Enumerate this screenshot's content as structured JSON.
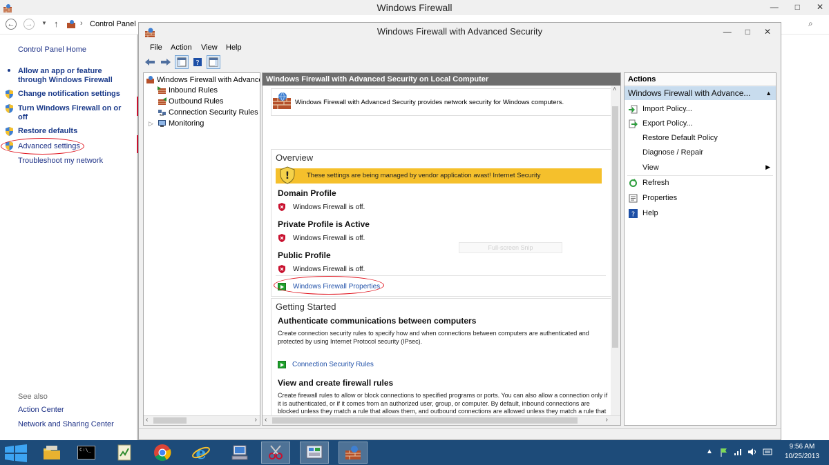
{
  "control_panel": {
    "title": "Windows Firewall",
    "window_buttons": {
      "minimize": "—",
      "maximize": "□",
      "close": "✕"
    },
    "address": {
      "back": "←",
      "forward": "→",
      "up": "↑",
      "separator": "›",
      "path": "Control Panel"
    },
    "left_links": [
      {
        "label": "Control Panel Home",
        "bold": false
      },
      {
        "label": "Allow an app or feature\nthrough Windows Firewall",
        "bold": true
      },
      {
        "label": "Change notification settings",
        "bold": true
      },
      {
        "label": "Turn Windows Firewall on or\noff",
        "bold": true
      },
      {
        "label": "Restore defaults",
        "bold": true
      },
      {
        "label": "Advanced settings",
        "bold": false
      },
      {
        "label": "Troubleshoot my network",
        "bold": false
      }
    ],
    "see_also": {
      "heading": "See also",
      "links": [
        "Action Center",
        "Network and Sharing Center"
      ]
    }
  },
  "mmc": {
    "title": "Windows Firewall with Advanced Security",
    "window_buttons": {
      "minimize": "—",
      "maximize": "□",
      "close": "✕"
    },
    "menu": [
      "File",
      "Action",
      "View",
      "Help"
    ],
    "tree": {
      "root": "Windows Firewall with Advance",
      "items": [
        "Inbound Rules",
        "Outbound Rules",
        "Connection Security Rules",
        "Monitoring"
      ],
      "expander": "▷"
    },
    "center": {
      "header": "Windows Firewall with Advanced Security on Local Computer",
      "intro": "Windows Firewall with Advanced Security provides network security for Windows computers.",
      "overview": {
        "title": "Overview",
        "banner": "These settings are being managed by vendor application avast! Internet Security",
        "profiles": [
          {
            "name": "Domain Profile",
            "status": "Windows Firewall is off."
          },
          {
            "name": "Private Profile is Active",
            "status": "Windows Firewall is off."
          },
          {
            "name": "Public Profile",
            "status": "Windows Firewall is off."
          }
        ],
        "properties_link": "Windows Firewall Properties"
      },
      "snip_overlay": "Full-screen Snip",
      "getting_started": {
        "title": "Getting Started",
        "auth_title": "Authenticate communications between computers",
        "auth_text": "Create connection security rules to specify how and when connections between computers are authenticated and protected by using Internet Protocol security (IPsec).",
        "auth_link": "Connection Security Rules",
        "rules_title": "View and create firewall rules",
        "rules_text": "Create firewall rules to allow or block connections to specified programs or ports. You can also allow a connection only if it is authenticated, or if it comes from an authorized user, group, or computer. By default, inbound connections are blocked unless they match a rule that allows them, and outbound connections are allowed unless they match a rule that blocks them."
      }
    },
    "actions": {
      "header": "Actions",
      "subheader": "Windows Firewall with Advance...",
      "items": [
        "Import Policy...",
        "Export Policy...",
        "Restore Default Policy",
        "Diagnose / Repair",
        "View",
        "Refresh",
        "Properties",
        "Help"
      ]
    }
  },
  "taskbar": {
    "time": "9:56 AM",
    "date": "10/25/2013",
    "cmd_label": "C:\\_"
  },
  "colors": {
    "taskbar": "#1d4b79",
    "banner": "#f5c02c",
    "center_header": "#6e6e6e",
    "actions_sub": "#c8dcee",
    "annotation_red": "#e0141e"
  }
}
